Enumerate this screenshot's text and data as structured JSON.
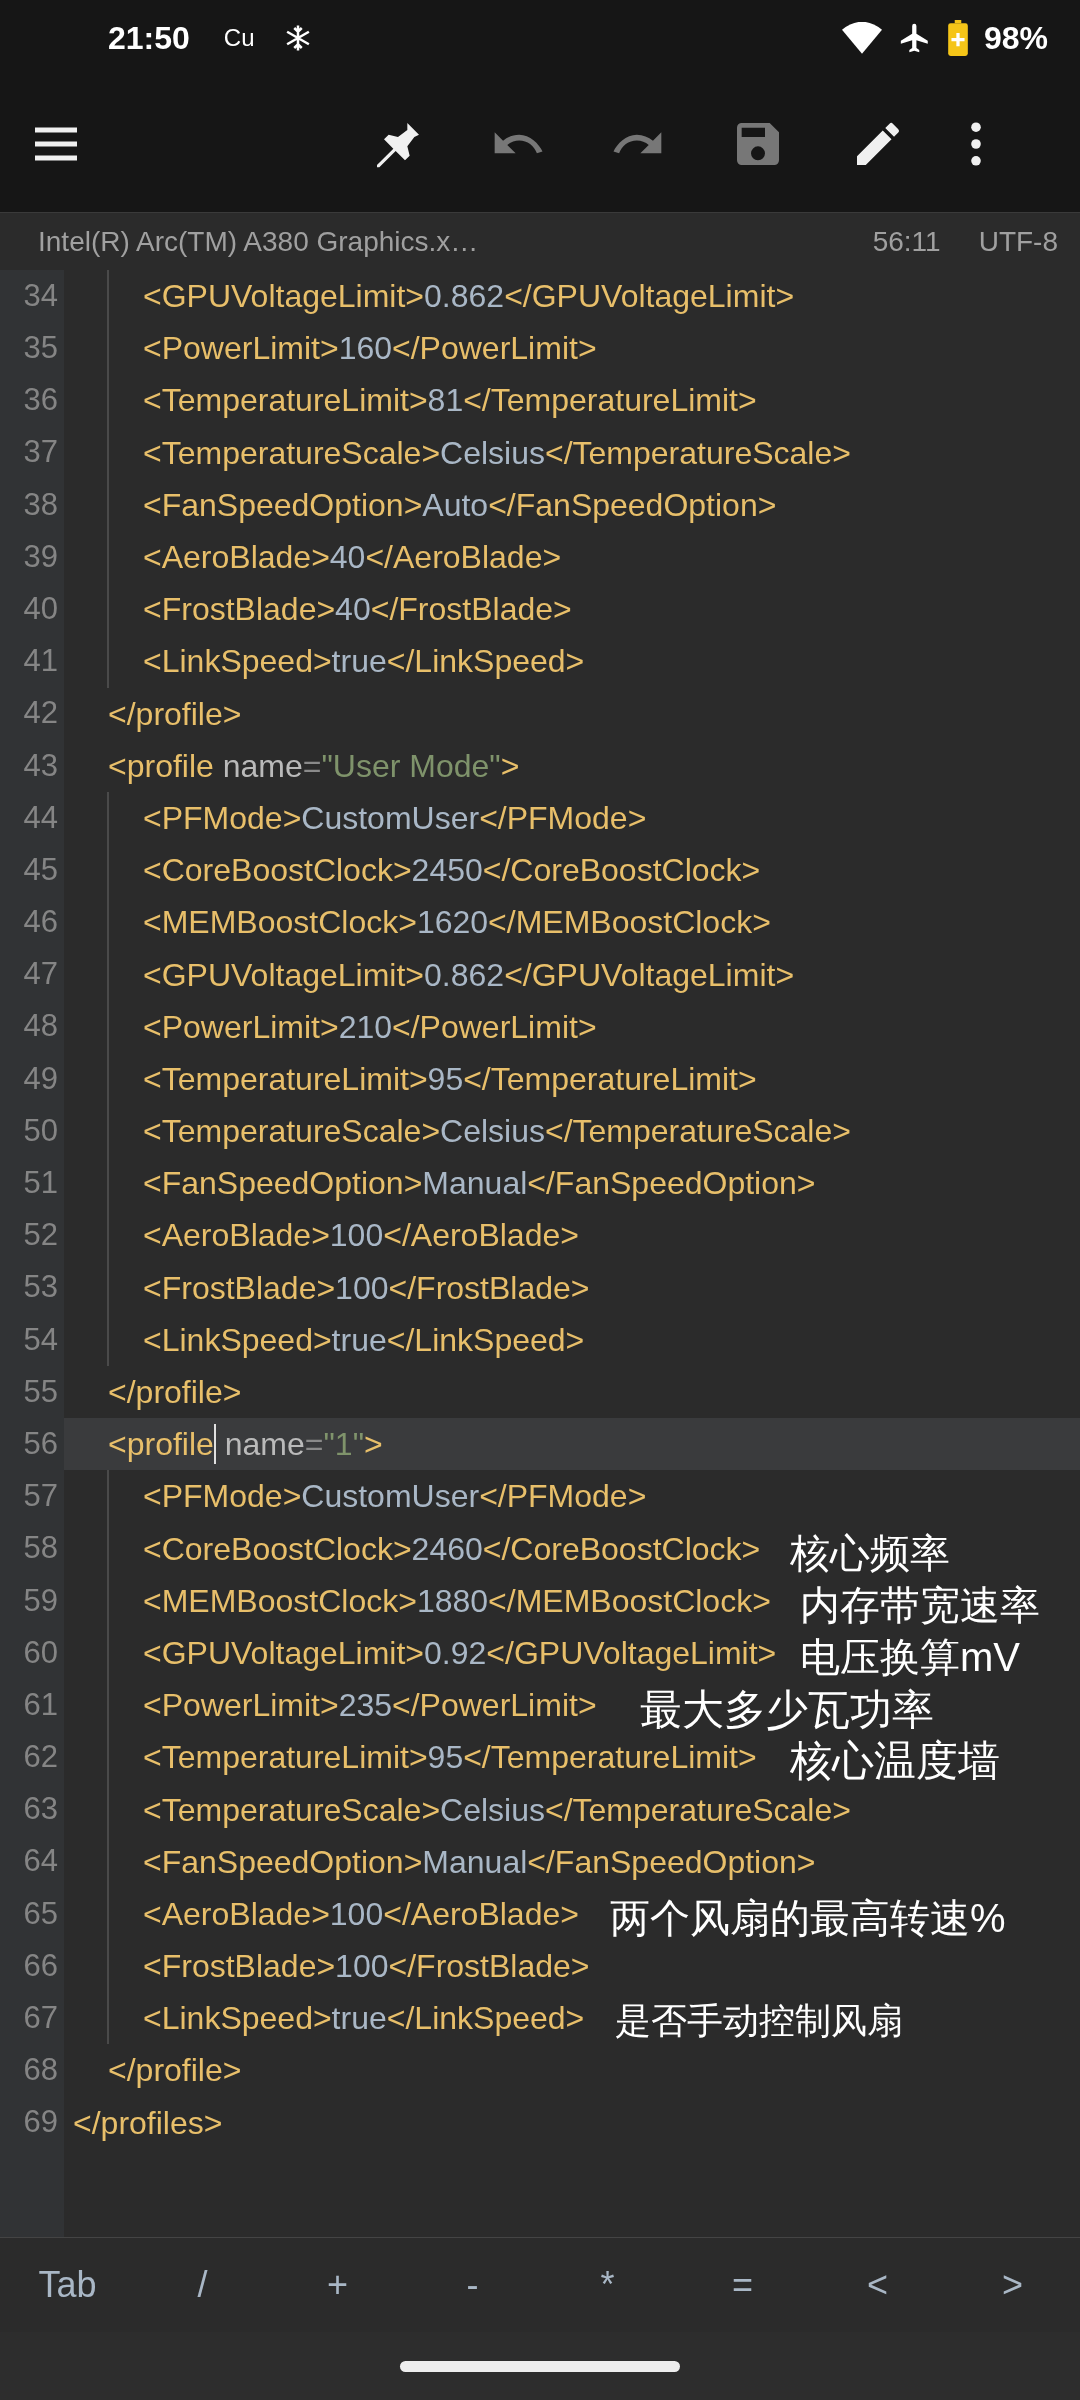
{
  "status_bar": {
    "time": "21:50",
    "carrier": "Cu",
    "battery": "98%"
  },
  "toolbar": {
    "buttons": [
      {
        "kind": "menu",
        "disabled": false
      },
      {
        "kind": "pin",
        "disabled": false
      },
      {
        "kind": "undo",
        "disabled": true
      },
      {
        "kind": "redo",
        "disabled": true
      },
      {
        "kind": "save",
        "disabled": true
      },
      {
        "kind": "edit",
        "disabled": false
      },
      {
        "kind": "more",
        "disabled": false
      }
    ]
  },
  "file_bar": {
    "filename": "Intel(R) Arc(TM) A380 Graphics.x…",
    "position": "56:11",
    "encoding": "UTF-8"
  },
  "code": {
    "lines": [
      {
        "children": [
          {
            "children": [
              {
                "number": "34",
                "current": false,
                "tokens": [
                  {
                    "kind": "tag",
                    "text": "<GPUVoltageLimit>"
                  },
                  {
                    "kind": "text",
                    "text": "0.862"
                  },
                  {
                    "kind": "tag",
                    "text": "</GPUVoltageLimit>"
                  }
                ]
              },
              {
                "number": "35",
                "current": false,
                "tokens": [
                  {
                    "kind": "tag",
                    "text": "<PowerLimit>"
                  },
                  {
                    "kind": "text",
                    "text": "160"
                  },
                  {
                    "kind": "tag",
                    "text": "</PowerLimit>"
                  }
                ]
              },
              {
                "number": "36",
                "current": false,
                "tokens": [
                  {
                    "kind": "tag",
                    "text": "<TemperatureLimit>"
                  },
                  {
                    "kind": "text",
                    "text": "81"
                  },
                  {
                    "kind": "tag",
                    "text": "</TemperatureLimit>"
                  }
                ]
              },
              {
                "number": "37",
                "current": false,
                "tokens": [
                  {
                    "kind": "tag",
                    "text": "<TemperatureScale>"
                  },
                  {
                    "kind": "text",
                    "text": "Celsius"
                  },
                  {
                    "kind": "tag",
                    "text": "</TemperatureScale>"
                  }
                ]
              },
              {
                "number": "38",
                "current": false,
                "tokens": [
                  {
                    "kind": "tag",
                    "text": "<FanSpeedOption>"
                  },
                  {
                    "kind": "text",
                    "text": "Auto"
                  },
                  {
                    "kind": "tag",
                    "text": "</FanSpeedOption>"
                  }
                ]
              },
              {
                "number": "39",
                "current": false,
                "tokens": [
                  {
                    "kind": "tag",
                    "text": "<AeroBlade>"
                  },
                  {
                    "kind": "text",
                    "text": "40"
                  },
                  {
                    "kind": "tag",
                    "text": "</AeroBlade>"
                  }
                ]
              },
              {
                "number": "40",
                "current": false,
                "tokens": [
                  {
                    "kind": "tag",
                    "text": "<FrostBlade>"
                  },
                  {
                    "kind": "text",
                    "text": "40"
                  },
                  {
                    "kind": "tag",
                    "text": "</FrostBlade>"
                  }
                ]
              },
              {
                "number": "41",
                "current": false,
                "tokens": [
                  {
                    "kind": "tag",
                    "text": "<LinkSpeed>"
                  },
                  {
                    "kind": "text",
                    "text": "true"
                  },
                  {
                    "kind": "tag",
                    "text": "</LinkSpeed>"
                  }
                ]
              }
            ]
          },
          {
            "number": "42",
            "current": false,
            "tokens": [
              {
                "kind": "tag",
                "text": "</profile>"
              }
            ]
          },
          {
            "number": "43",
            "current": false,
            "tokens": [
              {
                "kind": "tag",
                "text": "<profile"
              },
              {
                "kind": "attr",
                "text": " name"
              },
              {
                "kind": "eq",
                "text": "="
              },
              {
                "kind": "value",
                "text": "\"User Mode\""
              },
              {
                "kind": "tag",
                "text": ">"
              }
            ],
            "children": [
              {
                "number": "44",
                "current": false,
                "tokens": [
                  {
                    "kind": "tag",
                    "text": "<PFMode>"
                  },
                  {
                    "kind": "text",
                    "text": "CustomUser"
                  },
                  {
                    "kind": "tag",
                    "text": "</PFMode>"
                  }
                ]
              },
              {
                "number": "45",
                "current": false,
                "tokens": [
                  {
                    "kind": "tag",
                    "text": "<CoreBoostClock>"
                  },
                  {
                    "kind": "text",
                    "text": "2450"
                  },
                  {
                    "kind": "tag",
                    "text": "</CoreBoostClock>"
                  }
                ]
              },
              {
                "number": "46",
                "current": false,
                "tokens": [
                  {
                    "kind": "tag",
                    "text": "<MEMBoostClock>"
                  },
                  {
                    "kind": "text",
                    "text": "1620"
                  },
                  {
                    "kind": "tag",
                    "text": "</MEMBoostClock>"
                  }
                ]
              },
              {
                "number": "47",
                "current": false,
                "tokens": [
                  {
                    "kind": "tag",
                    "text": "<GPUVoltageLimit>"
                  },
                  {
                    "kind": "text",
                    "text": "0.862"
                  },
                  {
                    "kind": "tag",
                    "text": "</GPUVoltageLimit>"
                  }
                ]
              },
              {
                "number": "48",
                "current": false,
                "tokens": [
                  {
                    "kind": "tag",
                    "text": "<PowerLimit>"
                  },
                  {
                    "kind": "text",
                    "text": "210"
                  },
                  {
                    "kind": "tag",
                    "text": "</PowerLimit>"
                  }
                ]
              },
              {
                "number": "49",
                "current": false,
                "tokens": [
                  {
                    "kind": "tag",
                    "text": "<TemperatureLimit>"
                  },
                  {
                    "kind": "text",
                    "text": "95"
                  },
                  {
                    "kind": "tag",
                    "text": "</TemperatureLimit>"
                  }
                ]
              },
              {
                "number": "50",
                "current": false,
                "tokens": [
                  {
                    "kind": "tag",
                    "text": "<TemperatureScale>"
                  },
                  {
                    "kind": "text",
                    "text": "Celsius"
                  },
                  {
                    "kind": "tag",
                    "text": "</TemperatureScale>"
                  }
                ]
              },
              {
                "number": "51",
                "current": false,
                "tokens": [
                  {
                    "kind": "tag",
                    "text": "<FanSpeedOption>"
                  },
                  {
                    "kind": "text",
                    "text": "Manual"
                  },
                  {
                    "kind": "tag",
                    "text": "</FanSpeedOption>"
                  }
                ]
              },
              {
                "number": "52",
                "current": false,
                "tokens": [
                  {
                    "kind": "tag",
                    "text": "<AeroBlade>"
                  },
                  {
                    "kind": "text",
                    "text": "100"
                  },
                  {
                    "kind": "tag",
                    "text": "</AeroBlade>"
                  }
                ]
              },
              {
                "number": "53",
                "current": false,
                "tokens": [
                  {
                    "kind": "tag",
                    "text": "<FrostBlade>"
                  },
                  {
                    "kind": "text",
                    "text": "100"
                  },
                  {
                    "kind": "tag",
                    "text": "</FrostBlade>"
                  }
                ]
              },
              {
                "number": "54",
                "current": false,
                "tokens": [
                  {
                    "kind": "tag",
                    "text": "<LinkSpeed>"
                  },
                  {
                    "kind": "text",
                    "text": "true"
                  },
                  {
                    "kind": "tag",
                    "text": "</LinkSpeed>"
                  }
                ]
              }
            ]
          },
          {
            "number": "55",
            "current": false,
            "tokens": [
              {
                "kind": "tag",
                "text": "</profile>"
              }
            ]
          },
          {
            "number": "56",
            "current": true,
            "tokens": [
              {
                "kind": "tag",
                "text": "<profile"
              },
              {
                "kind": "cursor"
              },
              {
                "kind": "attr",
                "text": " name"
              },
              {
                "kind": "eq",
                "text": "="
              },
              {
                "kind": "value",
                "text": "\"1\""
              },
              {
                "kind": "tag",
                "text": ">"
              }
            ],
            "children": [
              {
                "number": "57",
                "current": false,
                "tokens": [
                  {
                    "kind": "tag",
                    "text": "<PFMode>"
                  },
                  {
                    "kind": "text",
                    "text": "CustomUser"
                  },
                  {
                    "kind": "tag",
                    "text": "</PFMode>"
                  }
                ]
              },
              {
                "number": "58",
                "current": false,
                "tokens": [
                  {
                    "kind": "tag",
                    "text": "<CoreBoostClock>"
                  },
                  {
                    "kind": "text",
                    "text": "2460"
                  },
                  {
                    "kind": "tag",
                    "text": "</CoreBoostClock>"
                  }
                ]
              },
              {
                "number": "59",
                "current": false,
                "tokens": [
                  {
                    "kind": "tag",
                    "text": "<MEMBoostClock>"
                  },
                  {
                    "kind": "text",
                    "text": "1880"
                  },
                  {
                    "kind": "tag",
                    "text": "</MEMBoostClock>"
                  }
                ]
              },
              {
                "number": "60",
                "current": false,
                "tokens": [
                  {
                    "kind": "tag",
                    "text": "<GPUVoltageLimit>"
                  },
                  {
                    "kind": "text",
                    "text": "0.92"
                  },
                  {
                    "kind": "tag",
                    "text": "</GPUVoltageLimit>"
                  }
                ]
              },
              {
                "number": "61",
                "current": false,
                "tokens": [
                  {
                    "kind": "tag",
                    "text": "<PowerLimit>"
                  },
                  {
                    "kind": "text",
                    "text": "235"
                  },
                  {
                    "kind": "tag",
                    "text": "</PowerLimit>"
                  }
                ]
              },
              {
                "number": "62",
                "current": false,
                "tokens": [
                  {
                    "kind": "tag",
                    "text": "<TemperatureLimit>"
                  },
                  {
                    "kind": "text",
                    "text": "95"
                  },
                  {
                    "kind": "tag",
                    "text": "</TemperatureLimit>"
                  }
                ]
              },
              {
                "number": "63",
                "current": false,
                "tokens": [
                  {
                    "kind": "tag",
                    "text": "<TemperatureScale>"
                  },
                  {
                    "kind": "text",
                    "text": "Celsius"
                  },
                  {
                    "kind": "tag",
                    "text": "</TemperatureScale>"
                  }
                ]
              },
              {
                "number": "64",
                "current": false,
                "tokens": [
                  {
                    "kind": "tag",
                    "text": "<FanSpeedOption>"
                  },
                  {
                    "kind": "text",
                    "text": "Manual"
                  },
                  {
                    "kind": "tag",
                    "text": "</FanSpeedOption>"
                  }
                ]
              },
              {
                "number": "65",
                "current": false,
                "tokens": [
                  {
                    "kind": "tag",
                    "text": "<AeroBlade>"
                  },
                  {
                    "kind": "text",
                    "text": "100"
                  },
                  {
                    "kind": "tag",
                    "text": "</AeroBlade>"
                  }
                ]
              },
              {
                "number": "66",
                "current": false,
                "tokens": [
                  {
                    "kind": "tag",
                    "text": "<FrostBlade>"
                  },
                  {
                    "kind": "text",
                    "text": "100"
                  },
                  {
                    "kind": "tag",
                    "text": "</FrostBlade>"
                  }
                ]
              },
              {
                "number": "67",
                "current": false,
                "tokens": [
                  {
                    "kind": "tag",
                    "text": "<LinkSpeed>"
                  },
                  {
                    "kind": "text",
                    "text": "true"
                  },
                  {
                    "kind": "tag",
                    "text": "</LinkSpeed>"
                  }
                ]
              }
            ]
          },
          {
            "number": "68",
            "current": false,
            "tokens": [
              {
                "kind": "tag",
                "text": "</profile>"
              }
            ]
          }
        ]
      },
      {
        "number": "69",
        "current": false,
        "tokens": [
          {
            "kind": "tag",
            "text": "</profiles>"
          }
        ]
      }
    ]
  },
  "annotations": [
    {
      "text": "核心频率"
    },
    {
      "text": "内存带宽速率"
    },
    {
      "text": "电压换算mV"
    },
    {
      "text": "最大多少瓦功率"
    },
    {
      "text": "核心温度墙"
    },
    {
      "text": "两个风扇的最高转速%"
    },
    {
      "text": "是否手动控制风扇"
    }
  ],
  "keys": [
    "Tab",
    "/",
    "+",
    "-",
    "*",
    "=",
    "<",
    ">"
  ]
}
